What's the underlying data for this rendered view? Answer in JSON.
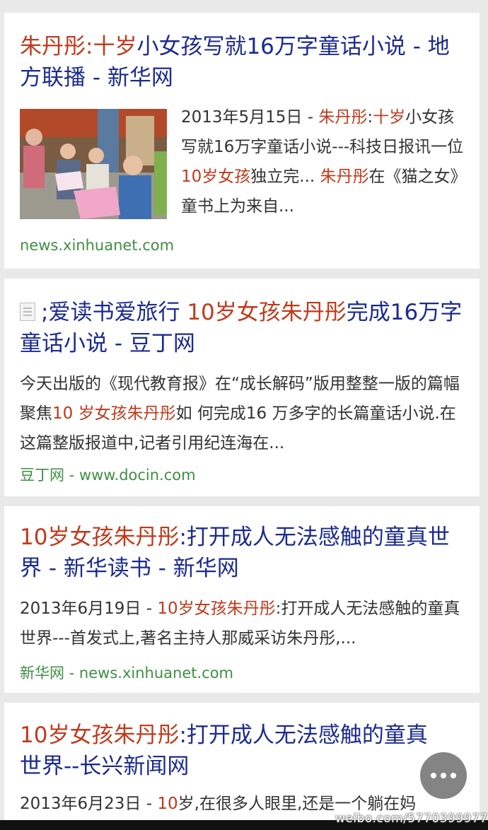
{
  "results": [
    {
      "title_hl1": "朱丹彤",
      "title_sep": ":",
      "title_hl2": "十岁",
      "title_plain1": "小女孩",
      "title_rest": "写就16万字童话小说 - 地方联播 - 新华网",
      "snippet_date": "2013年5月15日 - ",
      "snippet_hl1": "朱丹彤",
      "snippet_sep": ":",
      "snippet_hl2": "十岁",
      "snippet_t1": "小女孩写就16万字童话小说---科技日报讯一位",
      "snippet_hl3": "10岁女孩",
      "snippet_t2": "独立完... ",
      "snippet_hl4": "朱丹彤",
      "snippet_t3": "在《猫之女》童书上为来自...",
      "url": "news.xinhuanet.com"
    },
    {
      "title_prefix": ";爱读书爱旅行 ",
      "title_hl": "10岁女孩朱丹彤",
      "title_rest": "完成16万字童话小说 - 豆丁网",
      "snippet_t1": "今天出版的《现代教育报》在“成长解码”版用整整一版的篇幅聚焦",
      "snippet_hl": "10 岁女孩朱丹彤",
      "snippet_t2": "如 何完成16 万多字的长篇童话小说.在这篇整版报道中,记者引用纪连海在...",
      "url_site": "豆丁网",
      "url": " - www.docin.com"
    },
    {
      "title_hl": "10岁女孩朱丹彤",
      "title_rest": ":打开成人无法感触的童真世界 - 新华读书 - 新华网",
      "snippet_date": "2013年6月19日 - ",
      "snippet_hl": "10岁女孩朱丹彤",
      "snippet_t1": ":打开成人无法感触的童真世界---首发式上,著名主持人那威采访朱丹彤,...",
      "url_site": "新华网",
      "url": " - news.xinhuanet.com"
    },
    {
      "title_hl": "10岁女孩朱丹彤",
      "title_rest": ":打开成人无法感触的童真世界--长兴新闻网",
      "snippet_date": "2013年6月23日 - ",
      "snippet_hl": "10",
      "snippet_t1": "岁,在很多人眼里,还是一个躺在妈"
    }
  ],
  "watermark": "weibo.com/5770399977",
  "icons": {
    "fab": "more-icon",
    "doc": "document-icon"
  },
  "colors": {
    "title": "#1b2b8f",
    "highlight": "#c0391b",
    "url": "#3f8f42",
    "background": "#e9e9e9"
  }
}
